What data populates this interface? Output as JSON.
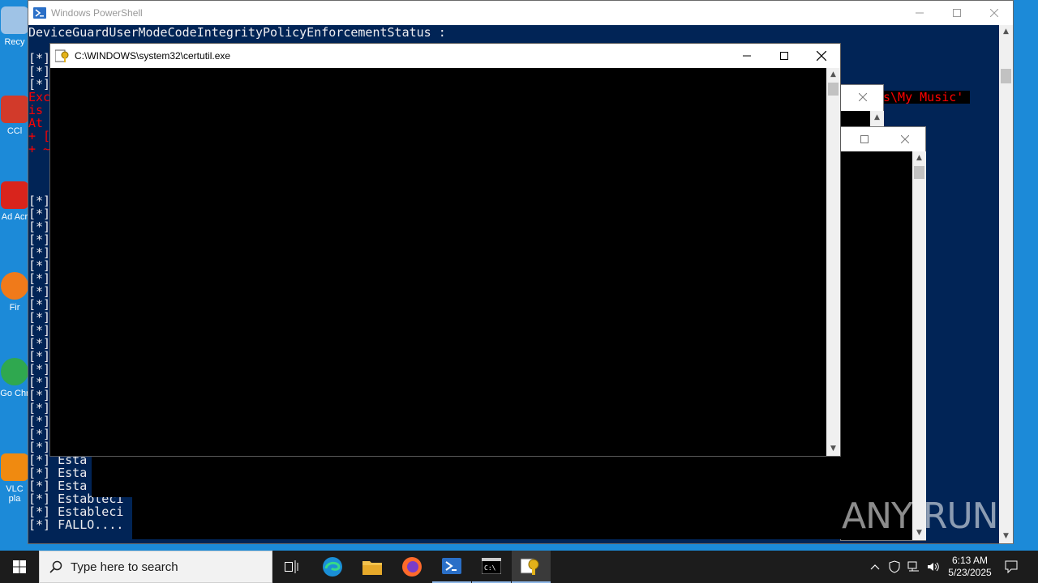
{
  "desktop": {
    "icons": [
      {
        "label": "Recy",
        "color": "#9fc3e6"
      },
      {
        "label": "CCl",
        "color": "#d23a2a"
      },
      {
        "label": "Ad Acr",
        "color": "#d9241c"
      },
      {
        "label": "Fir",
        "color": "#f07a1a"
      },
      {
        "label": "Go Chr",
        "color": "#2fa84f"
      },
      {
        "label": "VLC pla",
        "color": "#f08a10"
      }
    ]
  },
  "powershell": {
    "title": "Windows PowerShell",
    "line_top": "DeviceGuardUserModeCodeIntegrityPolicyEnforcementStatus :",
    "error_text": "s\\My Music'",
    "error_lines": [
      "Exc",
      "is ",
      "At ",
      "+ [",
      "+ ~"
    ],
    "bullet": "[*]",
    "bottom_lines": [
      "[*] Esta",
      "[*] Esta",
      "[*] Esta",
      "[*] Estableci",
      "[*] Estableci",
      "[*] FALLO...."
    ]
  },
  "certutil": {
    "title": "C:\\WINDOWS\\system32\\certutil.exe"
  },
  "taskbar": {
    "search_placeholder": "Type here to search",
    "time": "6:13 AM",
    "date": "5/23/2025"
  },
  "watermark": "ANY RUN"
}
